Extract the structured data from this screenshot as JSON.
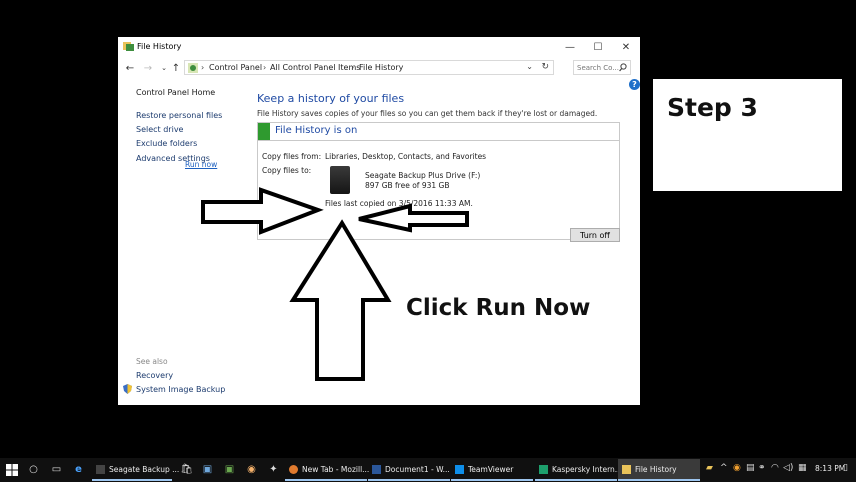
{
  "window": {
    "title": "File History",
    "controls": {
      "minimize": "—",
      "maximize": "☐",
      "close": "✕"
    }
  },
  "address_bar": {
    "breadcrumbs": [
      "Control Panel",
      "All Control Panel Items",
      "File History"
    ],
    "separator": "›",
    "search_placeholder": "Search Co..."
  },
  "sidebar": {
    "home": "Control Panel Home",
    "links": [
      "Restore personal files",
      "Select drive",
      "Exclude folders",
      "Advanced settings"
    ],
    "see_also_label": "See also",
    "see_also_links": [
      "Recovery",
      "System Image Backup"
    ]
  },
  "main": {
    "heading": "Keep a history of your files",
    "description": "File History saves copies of your files so you can get them back if they're lost or damaged.",
    "status_title": "File History is on",
    "status_color": "#2f9a2f",
    "copy_from_label": "Copy files from:",
    "copy_from_value": "Libraries, Desktop, Contacts, and Favorites",
    "copy_to_label": "Copy files to:",
    "drive_name": "Seagate Backup Plus Drive (F:)",
    "drive_space": "897 GB free of 931 GB",
    "last_copied": "Files last copied on 3/5/2016 11:33 AM.",
    "run_now": "Run now",
    "turn_off": "Turn off"
  },
  "overlay": {
    "step_label": "Step 3",
    "callout": "Click Run Now"
  },
  "taskbar": {
    "tasks": [
      {
        "label": "Seagate Backup ...",
        "icon": "drive-icon"
      },
      {
        "label": "New Tab - Mozill...",
        "icon": "firefox-icon"
      },
      {
        "label": "Document1 - W...",
        "icon": "word-icon"
      },
      {
        "label": "TeamViewer",
        "icon": "teamviewer-icon"
      },
      {
        "label": "Kaspersky Intern...",
        "icon": "kaspersky-icon"
      },
      {
        "label": "File History",
        "icon": "file-history-icon"
      }
    ],
    "clock": "8:13 PM"
  }
}
